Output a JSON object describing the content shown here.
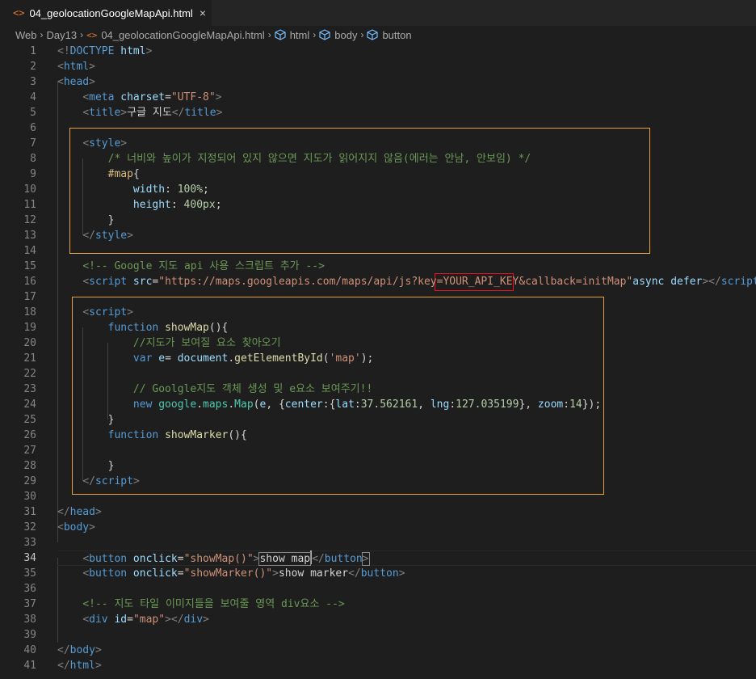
{
  "tab": {
    "filename": "04_geolocationGoogleMapApi.html",
    "close": "×",
    "icon": "html-file-icon"
  },
  "breadcrumb": {
    "items": [
      "Web",
      "Day13",
      "04_geolocationGoogleMapApi.html",
      "html",
      "body",
      "button"
    ],
    "separator": "›"
  },
  "editor": {
    "line_numbers": [
      "1",
      "2",
      "3",
      "4",
      "5",
      "6",
      "7",
      "8",
      "9",
      "10",
      "11",
      "12",
      "13",
      "14",
      "15",
      "16",
      "17",
      "18",
      "19",
      "20",
      "21",
      "22",
      "23",
      "24",
      "25",
      "26",
      "27",
      "28",
      "29",
      "30",
      "31",
      "32",
      "33",
      "34",
      "35",
      "36",
      "37",
      "38",
      "39",
      "40",
      "41"
    ],
    "lines": [
      [
        [
          "t",
          "<!"
        ],
        [
          "tag",
          "DOCTYPE"
        ],
        [
          "attr",
          " html"
        ],
        [
          "t",
          ">"
        ]
      ],
      [
        [
          "t",
          "<"
        ],
        [
          "tag",
          "html"
        ],
        [
          "t",
          ">"
        ]
      ],
      [
        [
          "t",
          "<"
        ],
        [
          "tag",
          "head"
        ],
        [
          "t",
          ">"
        ]
      ],
      [
        [
          "txt",
          "    "
        ],
        [
          "t",
          "<"
        ],
        [
          "tag",
          "meta"
        ],
        [
          "attr",
          " charset"
        ],
        [
          "txt",
          "="
        ],
        [
          "str",
          "\"UTF-8\""
        ],
        [
          "t",
          ">"
        ]
      ],
      [
        [
          "txt",
          "    "
        ],
        [
          "t",
          "<"
        ],
        [
          "tag",
          "title"
        ],
        [
          "t",
          ">"
        ],
        [
          "txt",
          "구글 지도"
        ],
        [
          "t",
          "</"
        ],
        [
          "tag",
          "title"
        ],
        [
          "t",
          ">"
        ]
      ],
      [],
      [
        [
          "txt",
          "    "
        ],
        [
          "t",
          "<"
        ],
        [
          "tag",
          "style"
        ],
        [
          "t",
          ">"
        ]
      ],
      [
        [
          "txt",
          "        "
        ],
        [
          "com",
          "/* 너비와 높이가 지정되어 있지 않으면 지도가 읽어지지 않음(에러는 안남, 안보임) */"
        ]
      ],
      [
        [
          "txt",
          "        "
        ],
        [
          "sel",
          "#map"
        ],
        [
          "txt",
          "{"
        ]
      ],
      [
        [
          "txt",
          "            "
        ],
        [
          "var",
          "width"
        ],
        [
          "txt",
          ": "
        ],
        [
          "num",
          "100%"
        ],
        [
          "txt",
          ";"
        ]
      ],
      [
        [
          "txt",
          "            "
        ],
        [
          "var",
          "height"
        ],
        [
          "txt",
          ": "
        ],
        [
          "num",
          "400px"
        ],
        [
          "txt",
          ";"
        ]
      ],
      [
        [
          "txt",
          "        }"
        ]
      ],
      [
        [
          "txt",
          "    "
        ],
        [
          "t",
          "</"
        ],
        [
          "tag",
          "style"
        ],
        [
          "t",
          ">"
        ]
      ],
      [],
      [
        [
          "txt",
          "    "
        ],
        [
          "com",
          "<!-- Google 지도 api 사용 스크립트 추가 -->"
        ]
      ],
      [
        [
          "txt",
          "    "
        ],
        [
          "t",
          "<"
        ],
        [
          "tag",
          "script"
        ],
        [
          "attr",
          " src"
        ],
        [
          "txt",
          "="
        ],
        [
          "str",
          "\"https://maps.googleapis.com/maps/api/js?key=YOUR_API_KEY&callback=initMap\""
        ],
        [
          "attr",
          "async"
        ],
        [
          "attr",
          " defer"
        ],
        [
          "t",
          "></"
        ],
        [
          "tag",
          "script"
        ],
        [
          "t",
          ">"
        ]
      ],
      [],
      [
        [
          "txt",
          "    "
        ],
        [
          "t",
          "<"
        ],
        [
          "tag",
          "script"
        ],
        [
          "t",
          ">"
        ]
      ],
      [
        [
          "txt",
          "        "
        ],
        [
          "kw",
          "function"
        ],
        [
          "txt",
          " "
        ],
        [
          "fn",
          "showMap"
        ],
        [
          "txt",
          "(){"
        ]
      ],
      [
        [
          "txt",
          "            "
        ],
        [
          "com",
          "//지도가 보여질 요소 찾아오기"
        ]
      ],
      [
        [
          "txt",
          "            "
        ],
        [
          "kw",
          "var"
        ],
        [
          "txt",
          " "
        ],
        [
          "var",
          "e"
        ],
        [
          "txt",
          "= "
        ],
        [
          "var",
          "document"
        ],
        [
          "txt",
          "."
        ],
        [
          "fn",
          "getElementById"
        ],
        [
          "txt",
          "("
        ],
        [
          "str",
          "'map'"
        ],
        [
          "txt",
          ");"
        ]
      ],
      [],
      [
        [
          "txt",
          "            "
        ],
        [
          "com",
          "// Goolgle지도 객체 생성 및 e요소 보여주기!!"
        ]
      ],
      [
        [
          "txt",
          "            "
        ],
        [
          "kw",
          "new"
        ],
        [
          "txt",
          " "
        ],
        [
          "cls",
          "google"
        ],
        [
          "txt",
          "."
        ],
        [
          "cls",
          "maps"
        ],
        [
          "txt",
          "."
        ],
        [
          "cls",
          "Map"
        ],
        [
          "txt",
          "("
        ],
        [
          "var",
          "e"
        ],
        [
          "txt",
          ", {"
        ],
        [
          "var",
          "center"
        ],
        [
          "txt",
          ":{"
        ],
        [
          "var",
          "lat"
        ],
        [
          "txt",
          ":"
        ],
        [
          "num",
          "37.562161"
        ],
        [
          "txt",
          ", "
        ],
        [
          "var",
          "lng"
        ],
        [
          "txt",
          ":"
        ],
        [
          "num",
          "127.035199"
        ],
        [
          "txt",
          "}, "
        ],
        [
          "var",
          "zoom"
        ],
        [
          "txt",
          ":"
        ],
        [
          "num",
          "14"
        ],
        [
          "txt",
          "});"
        ]
      ],
      [
        [
          "txt",
          "        }"
        ]
      ],
      [
        [
          "txt",
          "        "
        ],
        [
          "kw",
          "function"
        ],
        [
          "txt",
          " "
        ],
        [
          "fn",
          "showMarker"
        ],
        [
          "txt",
          "(){"
        ]
      ],
      [],
      [
        [
          "txt",
          "        }"
        ]
      ],
      [
        [
          "txt",
          "    "
        ],
        [
          "t",
          "</"
        ],
        [
          "tag",
          "script"
        ],
        [
          "t",
          ">"
        ]
      ],
      [],
      [
        [
          "t",
          "</"
        ],
        [
          "tag",
          "head"
        ],
        [
          "t",
          ">"
        ]
      ],
      [
        [
          "t",
          "<"
        ],
        [
          "tag",
          "body"
        ],
        [
          "t",
          ">"
        ]
      ],
      [],
      [
        [
          "txt",
          "    "
        ],
        [
          "t",
          "<"
        ],
        [
          "tag",
          "button"
        ],
        [
          "attr",
          " onclick"
        ],
        [
          "txt",
          "="
        ],
        [
          "str",
          "\"showMap()\""
        ],
        [
          "t",
          ">"
        ],
        [
          "txt",
          "show map"
        ],
        [
          "t",
          "</"
        ],
        [
          "tag",
          "button"
        ],
        [
          "t",
          ">"
        ]
      ],
      [
        [
          "txt",
          "    "
        ],
        [
          "t",
          "<"
        ],
        [
          "tag",
          "button"
        ],
        [
          "attr",
          " onclick"
        ],
        [
          "txt",
          "="
        ],
        [
          "str",
          "\"showMarker()\""
        ],
        [
          "t",
          ">"
        ],
        [
          "txt",
          "show marker"
        ],
        [
          "t",
          "</"
        ],
        [
          "tag",
          "button"
        ],
        [
          "t",
          ">"
        ]
      ],
      [],
      [
        [
          "txt",
          "    "
        ],
        [
          "com",
          "<!-- 지도 타일 이미지들을 보여줄 영역 div요소 -->"
        ]
      ],
      [
        [
          "txt",
          "    "
        ],
        [
          "t",
          "<"
        ],
        [
          "tag",
          "div"
        ],
        [
          "attr",
          " id"
        ],
        [
          "txt",
          "="
        ],
        [
          "str",
          "\"map\""
        ],
        [
          "t",
          "></"
        ],
        [
          "tag",
          "div"
        ],
        [
          "t",
          ">"
        ]
      ],
      [],
      [
        [
          "t",
          "</"
        ],
        [
          "tag",
          "body"
        ],
        [
          "t",
          ">"
        ]
      ],
      [
        [
          "t",
          "</"
        ],
        [
          "tag",
          "html"
        ],
        [
          "t",
          ">"
        ]
      ]
    ]
  },
  "colors": {
    "background": "#1e1e1e",
    "highlight_box": "#e8a33d",
    "api_key_box": "#e81123"
  }
}
